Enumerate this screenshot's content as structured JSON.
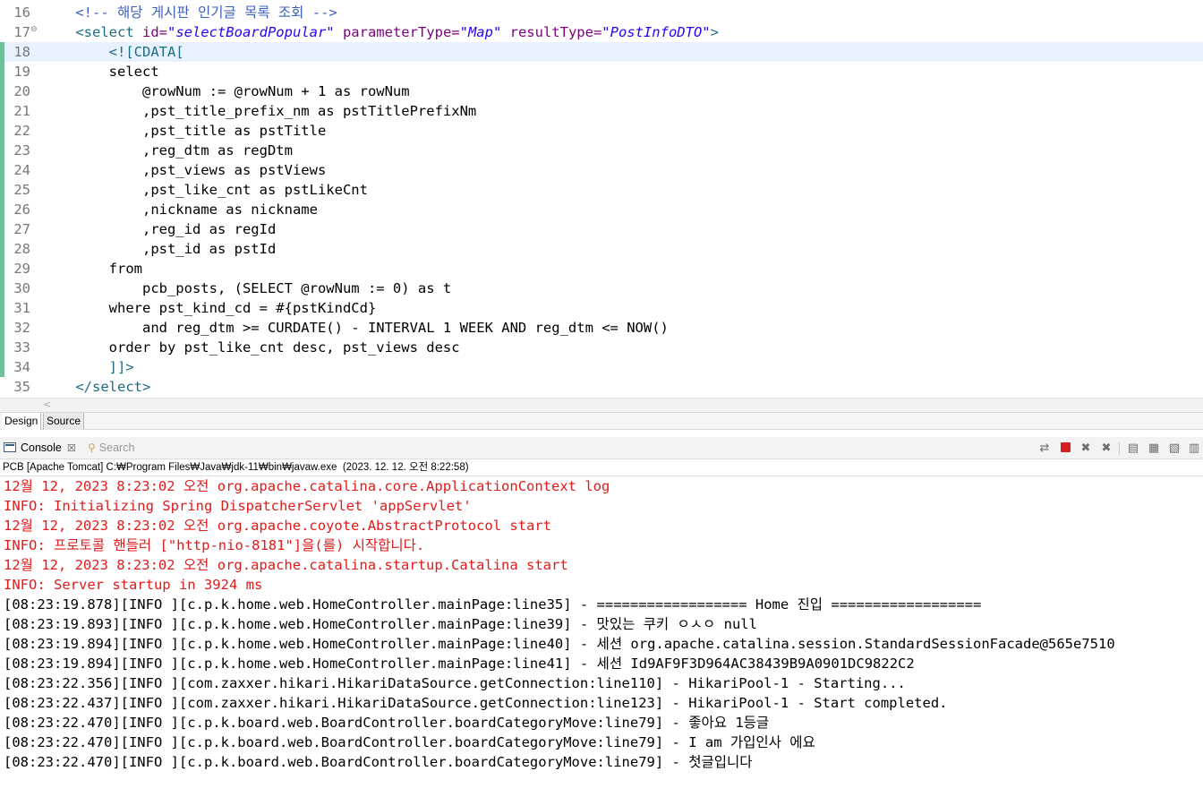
{
  "editor": {
    "lines": [
      {
        "num": "16",
        "fold": "",
        "current": false,
        "changed": false,
        "parts": [
          [
            "    ",
            ""
          ],
          [
            "<!-- 해당 게시판 인기글 목록 조회 -->",
            "comment"
          ]
        ]
      },
      {
        "num": "17",
        "fold": "⊖",
        "current": false,
        "changed": false,
        "parts": [
          [
            "    ",
            ""
          ],
          [
            "<select ",
            "tag"
          ],
          [
            "id=",
            "attr"
          ],
          [
            "\"selectBoardPopular\"",
            "val"
          ],
          [
            " ",
            ""
          ],
          [
            "parameterType=",
            "attr"
          ],
          [
            "\"Map\"",
            "val"
          ],
          [
            " ",
            ""
          ],
          [
            "resultType=",
            "attr"
          ],
          [
            "\"PostInfoDTO\"",
            "val"
          ],
          [
            ">",
            "tag"
          ]
        ]
      },
      {
        "num": "18",
        "fold": "",
        "current": true,
        "changed": true,
        "parts": [
          [
            "        ",
            ""
          ],
          [
            "<![CDATA[",
            "cdata"
          ]
        ]
      },
      {
        "num": "19",
        "fold": "",
        "current": false,
        "changed": true,
        "parts": [
          [
            "        select",
            "kw"
          ]
        ]
      },
      {
        "num": "20",
        "fold": "",
        "current": false,
        "changed": true,
        "parts": [
          [
            "            @rowNum := @rowNum + 1 as rowNum",
            "kw"
          ]
        ]
      },
      {
        "num": "21",
        "fold": "",
        "current": false,
        "changed": true,
        "parts": [
          [
            "            ,pst_title_prefix_nm as pstTitlePrefixNm",
            "kw"
          ]
        ]
      },
      {
        "num": "22",
        "fold": "",
        "current": false,
        "changed": true,
        "parts": [
          [
            "            ,pst_title as pstTitle",
            "kw"
          ]
        ]
      },
      {
        "num": "23",
        "fold": "",
        "current": false,
        "changed": true,
        "parts": [
          [
            "            ,reg_dtm as regDtm",
            "kw"
          ]
        ]
      },
      {
        "num": "24",
        "fold": "",
        "current": false,
        "changed": true,
        "parts": [
          [
            "            ,pst_views as pstViews",
            "kw"
          ]
        ]
      },
      {
        "num": "25",
        "fold": "",
        "current": false,
        "changed": true,
        "parts": [
          [
            "            ,pst_like_cnt as pstLikeCnt",
            "kw"
          ]
        ]
      },
      {
        "num": "26",
        "fold": "",
        "current": false,
        "changed": true,
        "parts": [
          [
            "            ,nickname as nickname",
            "kw"
          ]
        ]
      },
      {
        "num": "27",
        "fold": "",
        "current": false,
        "changed": true,
        "parts": [
          [
            "            ,reg_id as regId",
            "kw"
          ]
        ]
      },
      {
        "num": "28",
        "fold": "",
        "current": false,
        "changed": true,
        "parts": [
          [
            "            ,pst_id as pstId",
            "kw"
          ]
        ]
      },
      {
        "num": "29",
        "fold": "",
        "current": false,
        "changed": true,
        "parts": [
          [
            "        from",
            "kw"
          ]
        ]
      },
      {
        "num": "30",
        "fold": "",
        "current": false,
        "changed": true,
        "parts": [
          [
            "            pcb_posts, (SELECT @rowNum := 0) as t",
            "kw"
          ]
        ]
      },
      {
        "num": "31",
        "fold": "",
        "current": false,
        "changed": true,
        "parts": [
          [
            "        where pst_kind_cd = #{pstKindCd}",
            "kw"
          ]
        ]
      },
      {
        "num": "32",
        "fold": "",
        "current": false,
        "changed": true,
        "parts": [
          [
            "            and reg_dtm >= CURDATE() - INTERVAL 1 WEEK AND reg_dtm <= NOW()",
            "kw"
          ]
        ]
      },
      {
        "num": "33",
        "fold": "",
        "current": false,
        "changed": true,
        "parts": [
          [
            "        order by pst_like_cnt desc, pst_views desc",
            "kw"
          ]
        ]
      },
      {
        "num": "34",
        "fold": "",
        "current": false,
        "changed": true,
        "parts": [
          [
            "        ",
            ""
          ],
          [
            "]]>",
            "cdata"
          ]
        ]
      },
      {
        "num": "35",
        "fold": "",
        "current": false,
        "changed": false,
        "parts": [
          [
            "    ",
            ""
          ],
          [
            "</select>",
            "tag"
          ]
        ]
      }
    ],
    "tabs": {
      "design": "Design",
      "source": "Source"
    },
    "scroll_arrow": "<"
  },
  "console": {
    "tab_label": "Console",
    "tab_close": "☒",
    "search_label": "Search",
    "toolbar_icons": [
      "link-icon",
      "stop-icon",
      "remove-icon",
      "remove-all-icon",
      "clear-icon",
      "scroll-lock-icon",
      "word-wrap-icon",
      "pin-icon"
    ],
    "process": "PCB [Apache Tomcat] C:₩Program Files₩Java₩jdk-11₩bin₩javaw.exe  (2023. 12. 12. 오전 8:22:58)",
    "lines": [
      {
        "text": "12월 12, 2023 8:23:02 오전 org.apache.catalina.core.ApplicationContext log",
        "type": "err"
      },
      {
        "text": "INFO: Initializing Spring DispatcherServlet 'appServlet'",
        "type": "err"
      },
      {
        "text": "12월 12, 2023 8:23:02 오전 org.apache.coyote.AbstractProtocol start",
        "type": "err"
      },
      {
        "text": "INFO: 프로토콜 핸들러 [\"http-nio-8181\"]을(를) 시작합니다.",
        "type": "err"
      },
      {
        "text": "12월 12, 2023 8:23:02 오전 org.apache.catalina.startup.Catalina start",
        "type": "err"
      },
      {
        "text": "INFO: Server startup in 3924 ms",
        "type": "err"
      },
      {
        "text": "[08:23:19.878][INFO ][c.p.k.home.web.HomeController.mainPage:line35] - ================== Home 진입 ==================",
        "type": "out"
      },
      {
        "text": "[08:23:19.893][INFO ][c.p.k.home.web.HomeController.mainPage:line39] - 맛있는 쿠키 ㅇㅅㅇ null",
        "type": "out"
      },
      {
        "text": "[08:23:19.894][INFO ][c.p.k.home.web.HomeController.mainPage:line40] - 세션 org.apache.catalina.session.StandardSessionFacade@565e7510",
        "type": "out"
      },
      {
        "text": "[08:23:19.894][INFO ][c.p.k.home.web.HomeController.mainPage:line41] - 세션 Id9AF9F3D964AC38439B9A0901DC9822C2",
        "type": "out"
      },
      {
        "text": "[08:23:22.356][INFO ][com.zaxxer.hikari.HikariDataSource.getConnection:line110] - HikariPool-1 - Starting...",
        "type": "out"
      },
      {
        "text": "[08:23:22.437][INFO ][com.zaxxer.hikari.HikariDataSource.getConnection:line123] - HikariPool-1 - Start completed.",
        "type": "out"
      },
      {
        "text": "[08:23:22.470][INFO ][c.p.k.board.web.BoardController.boardCategoryMove:line79] - 좋아요 1등글",
        "type": "out"
      },
      {
        "text": "[08:23:22.470][INFO ][c.p.k.board.web.BoardController.boardCategoryMove:line79] - I am 가입인사 에요",
        "type": "out"
      },
      {
        "text": "[08:23:22.470][INFO ][c.p.k.board.web.BoardController.boardCategoryMove:line79] - 첫글입니다",
        "type": "out"
      }
    ]
  }
}
